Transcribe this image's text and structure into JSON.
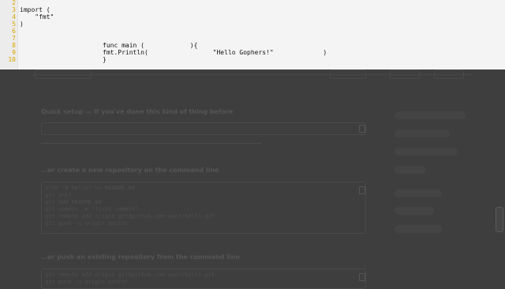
{
  "editor": {
    "line_numbers": [
      "2",
      "3",
      "4",
      "5",
      "6",
      "7",
      "8",
      "9",
      "10"
    ],
    "lines": [
      {
        "text": ""
      },
      {
        "text": "import ("
      },
      {
        "text": "    \"fmt\""
      },
      {
        "text": ")"
      },
      {
        "text": ""
      },
      {
        "text": ""
      },
      {
        "text": "func main (            ){"
      },
      {
        "text": "fmt.Println(                 \"Hello Gophers!\"             )"
      },
      {
        "text": "}"
      }
    ]
  },
  "background_page": {
    "repo_title": "",
    "quick_setup": "Quick setup — if you've done this kind of thing before",
    "section_create": "…or create a new repository on the command line",
    "section_push": "…or push an existing repository from the command line",
    "create_commands": [
      "echo \"# hello\" >> README.md",
      "git init",
      "git add README.md",
      "git commit -m \"first commit\"",
      "git remote add origin git@github.com:user/hello.git",
      "git push -u origin master"
    ],
    "push_commands": [
      "git remote add origin git@github.com:user/hello.git",
      "git push -u origin master"
    ]
  },
  "colors": {
    "editor_bg": "#f4f4f4",
    "line_number": "#d9a600",
    "overlay": "#3e3e3e"
  }
}
